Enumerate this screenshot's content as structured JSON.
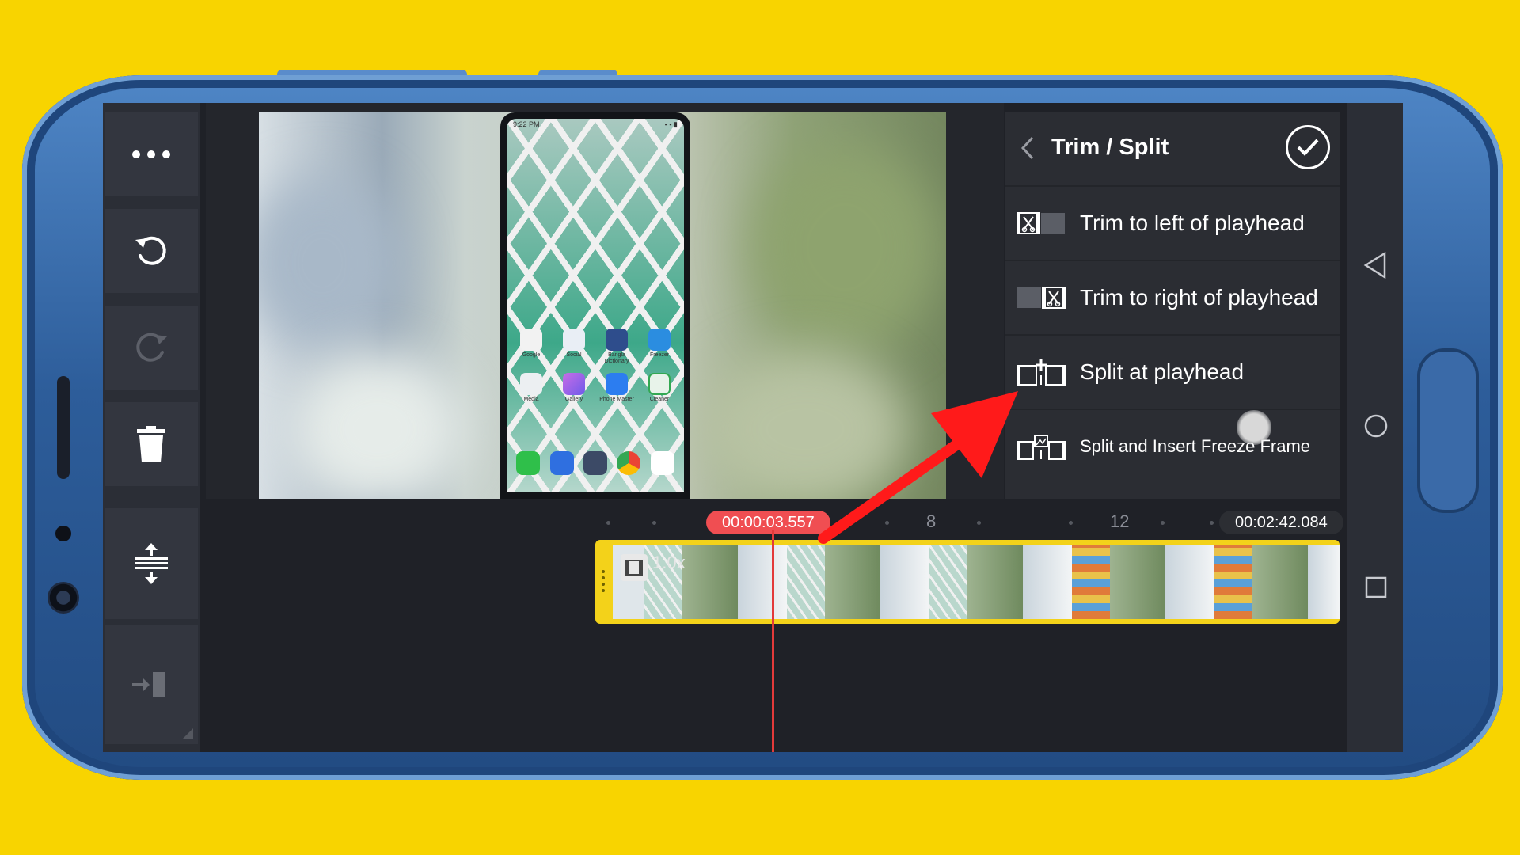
{
  "panel": {
    "title": "Trim / Split",
    "options": [
      {
        "label": "Trim to left of playhead"
      },
      {
        "label": "Trim to right of playhead"
      },
      {
        "label": "Split at playhead"
      },
      {
        "label": "Split and Insert Freeze Frame"
      }
    ]
  },
  "left_toolbar": {
    "items": [
      "more-icon",
      "undo-icon",
      "redo-icon",
      "delete-icon",
      "expand-tracks-icon",
      "jump-to-end-icon"
    ]
  },
  "timeline": {
    "current_time": "00:00:03.557",
    "total_time": "00:02:42.084",
    "marks": [
      "8",
      "12"
    ],
    "clip_speed": "1.0x"
  },
  "preview": {
    "status_time": "9:22 PM",
    "apps": [
      {
        "label": "Google"
      },
      {
        "label": "Social"
      },
      {
        "label": "Bangla Dictionary"
      },
      {
        "label": "Freezer"
      },
      {
        "label": "Media"
      },
      {
        "label": "Gallery"
      },
      {
        "label": "Phone Master"
      },
      {
        "label": "Cleaner"
      }
    ]
  },
  "colors": {
    "background": "#f8d400",
    "accent_clip": "#f3d21a",
    "playhead": "#e33a3a",
    "annotation_arrow": "#ff1a1a"
  }
}
